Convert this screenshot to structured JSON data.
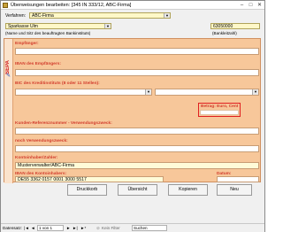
{
  "window": {
    "title": "Überweisungen bearbeiten: [345 IN 333/12, ABC-Firma]",
    "minimize": "–",
    "maximize": "□",
    "close": "✕"
  },
  "top": {
    "verfahren_label": "Verfahren:",
    "verfahren_value": "ABC-Firma",
    "bank_value": "Sparkasse Ulm",
    "blz_value": "63050000",
    "bank_hint": "(Name und Sitz des beauftragten Bankinstituts)",
    "blz_hint": "(Bankleitzahl)"
  },
  "form": {
    "sepa_label": "SEPA",
    "empfaenger_label": "Empfänger:",
    "empfaenger_value": "",
    "iban_empf_label": "IBAN des Empfängers:",
    "iban_empf_value": "",
    "bic_label": "BIC des Kreditinstituts (8 oder 11 Stellen):",
    "bic_value": "",
    "betrag_label": "Betrag: Euro, Cent",
    "betrag_value": "",
    "kundenref_label": "Kunden-Referenznummer - Verwendungszweck:",
    "kundenref_value": "",
    "noch_label": "noch Verwendungszweck:",
    "noch_value": "",
    "kontoinhaber_label": "Kontoinhaber/Zahler:",
    "kontoinhaber_value": "Musterverwalter/ABC-Firma",
    "iban_konto_label": "IBAN des Kontoinhabers:",
    "iban_konto_value": "DE55 3362 0157 0001 3000 5517",
    "datum_label": "Datum:",
    "datum_value": ""
  },
  "buttons": {
    "druckkorb": "Druckkorb",
    "uebersicht": "Übersicht",
    "kopieren": "Kopieren",
    "neu": "Neu"
  },
  "statusbar": {
    "datensatz_label": "Datensatz:",
    "first": "|◄",
    "prev": "◄",
    "position": "1 von 1",
    "next": "►",
    "last": "►|",
    "new": "►*",
    "filter": "Kein Filter",
    "search": "Suchen"
  },
  "colors": {
    "panel": "#f7c79a",
    "label_red": "#d23c2c",
    "field_yellow": "#fff8c8",
    "highlight_box": "#e02020"
  }
}
